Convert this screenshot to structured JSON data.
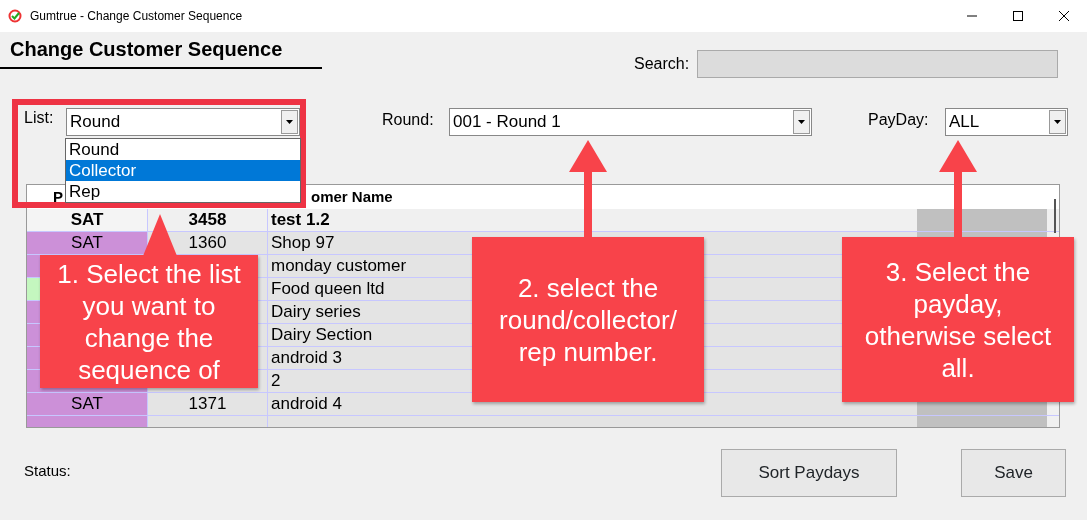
{
  "window": {
    "title": "Gumtrue - Change Customer Sequence"
  },
  "heading": "Change Customer Sequence",
  "search": {
    "label": "Search:"
  },
  "filters": [
    {
      "label": "List:",
      "value": "Round"
    },
    {
      "label": "Round:",
      "value": "001 - Round 1"
    },
    {
      "label": "PayDay:",
      "value": "ALL"
    }
  ],
  "list_dropdown": {
    "options": [
      {
        "label": "Round",
        "selected": false
      },
      {
        "label": "Collector",
        "selected": true
      },
      {
        "label": "Rep",
        "selected": false
      }
    ]
  },
  "table": {
    "columns": [
      {
        "label": "P"
      },
      {},
      {
        "label": "omer Name"
      },
      {}
    ],
    "rows": [
      {
        "color": "#f4f4f4",
        "bold": true,
        "payday": "SAT",
        "number": "3458",
        "name": "test 1.2"
      },
      {
        "color": "#cc90d8",
        "bold": false,
        "payday": "SAT",
        "number": "1360",
        "name": "Shop 97"
      },
      {
        "color": "#cc90d8",
        "bold": false,
        "name": "monday customer"
      },
      {
        "color": "#c4f7bf",
        "bold": false,
        "name": "Food queen ltd"
      },
      {
        "color": "#cc90d8",
        "bold": false,
        "name": "Dairy series"
      },
      {
        "color": "#cc90d8",
        "bold": false,
        "name": "Dairy Section"
      },
      {
        "color": "#cc90d8",
        "bold": false,
        "name": "android 3"
      },
      {
        "color": "#cc90d8",
        "bold": false,
        "name": "2"
      },
      {
        "color": "#cc90d8",
        "bold": false,
        "payday": "SAT",
        "number": "1371",
        "name": "android 4"
      },
      {
        "color": "#cc90d8",
        "bold": false
      }
    ]
  },
  "status": {
    "label": "Status:"
  },
  "buttons": [
    "Sort Paydays",
    "Save"
  ],
  "callouts": [
    {
      "text": "1. Select the list you want to change the sequence of"
    },
    {
      "text": "2. select the round/collector/ rep number."
    },
    {
      "text": "3. Select the payday, otherwise select all."
    }
  ]
}
